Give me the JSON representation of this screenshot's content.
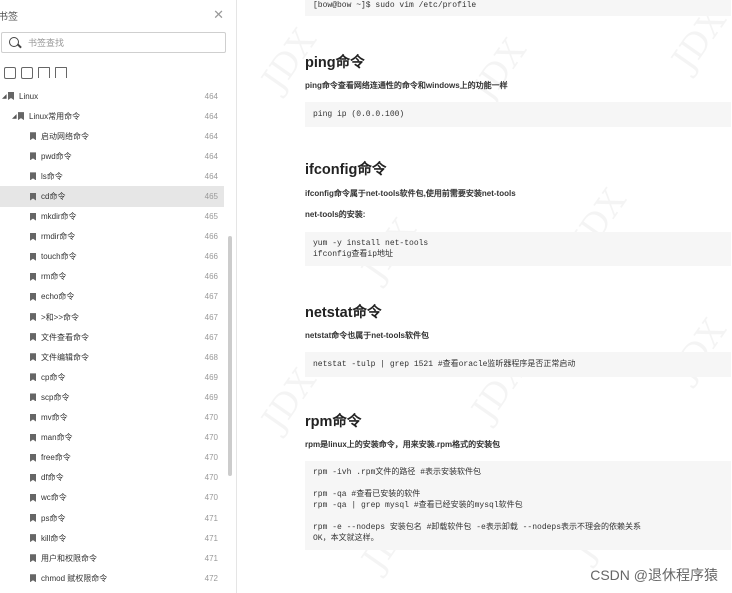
{
  "sidebar": {
    "title": "书签",
    "search_placeholder": "书签查找",
    "items": [
      {
        "label": "Linux",
        "page": "464",
        "level": 0
      },
      {
        "label": "Linux常用命令",
        "page": "464",
        "level": 1
      },
      {
        "label": "启动网络命令",
        "page": "464",
        "level": 2
      },
      {
        "label": "pwd命令",
        "page": "464",
        "level": 2
      },
      {
        "label": "ls命令",
        "page": "464",
        "level": 2
      },
      {
        "label": "cd命令",
        "page": "465",
        "level": 2,
        "selected": true
      },
      {
        "label": "mkdir命令",
        "page": "465",
        "level": 2
      },
      {
        "label": "rmdir命令",
        "page": "466",
        "level": 2
      },
      {
        "label": "touch命令",
        "page": "466",
        "level": 2
      },
      {
        "label": "rm命令",
        "page": "466",
        "level": 2
      },
      {
        "label": "echo命令",
        "page": "467",
        "level": 2
      },
      {
        "label": ">和>>命令",
        "page": "467",
        "level": 2
      },
      {
        "label": "文件查看命令",
        "page": "467",
        "level": 2
      },
      {
        "label": "文件编辑命令",
        "page": "468",
        "level": 2
      },
      {
        "label": "cp命令",
        "page": "469",
        "level": 2
      },
      {
        "label": "scp命令",
        "page": "469",
        "level": 2
      },
      {
        "label": "mv命令",
        "page": "470",
        "level": 2
      },
      {
        "label": "man命令",
        "page": "470",
        "level": 2
      },
      {
        "label": "free命令",
        "page": "470",
        "level": 2
      },
      {
        "label": "df命令",
        "page": "470",
        "level": 2
      },
      {
        "label": "wc命令",
        "page": "470",
        "level": 2
      },
      {
        "label": "ps命令",
        "page": "471",
        "level": 2
      },
      {
        "label": "kill命令",
        "page": "471",
        "level": 2
      },
      {
        "label": "用户和权限命令",
        "page": "471",
        "level": 2
      },
      {
        "label": "chmod 赋权限命令",
        "page": "472",
        "level": 2
      }
    ]
  },
  "main": {
    "top_code": "[bow@bow ~]$ sudo vim /etc/profile",
    "ping": {
      "heading": "ping命令",
      "desc": "ping命令查看网络连通性的命令和windows上的功能一样",
      "code": [
        "ping ip (0.0.0.100)"
      ]
    },
    "ifconfig": {
      "heading": "ifconfig命令",
      "desc": "ifconfig命令属于net-tools软件包,使用前需要安装net-tools",
      "desc2": "net-tools的安装:",
      "code": [
        "yum -y install net-tools",
        "ifconfig查看ip地址"
      ]
    },
    "netstat": {
      "heading": "netstat命令",
      "desc": "netstat命令也属于net-tools软件包",
      "code": [
        "netstat -tulp | grep 1521 #查看oracle监听器程序是否正常启动"
      ]
    },
    "rpm": {
      "heading": "rpm命令",
      "desc": "rpm是linux上的安装命令，用来安装.rpm格式的安装包",
      "code": [
        "rpm -ivh .rpm文件的路径 #表示安装软件包",
        "",
        "rpm -qa #查看已安装的软件",
        "rpm -qa | grep mysql #查看已经安装的mysql软件包",
        "",
        "rpm -e --nodeps 安装包名 #卸载软件包 -e表示卸载 --nodeps表示不理会的依赖关系",
        "OK，本文就这样。"
      ]
    },
    "watermark_text": "JDX",
    "csdn_credit": "CSDN @退休程序猿"
  }
}
